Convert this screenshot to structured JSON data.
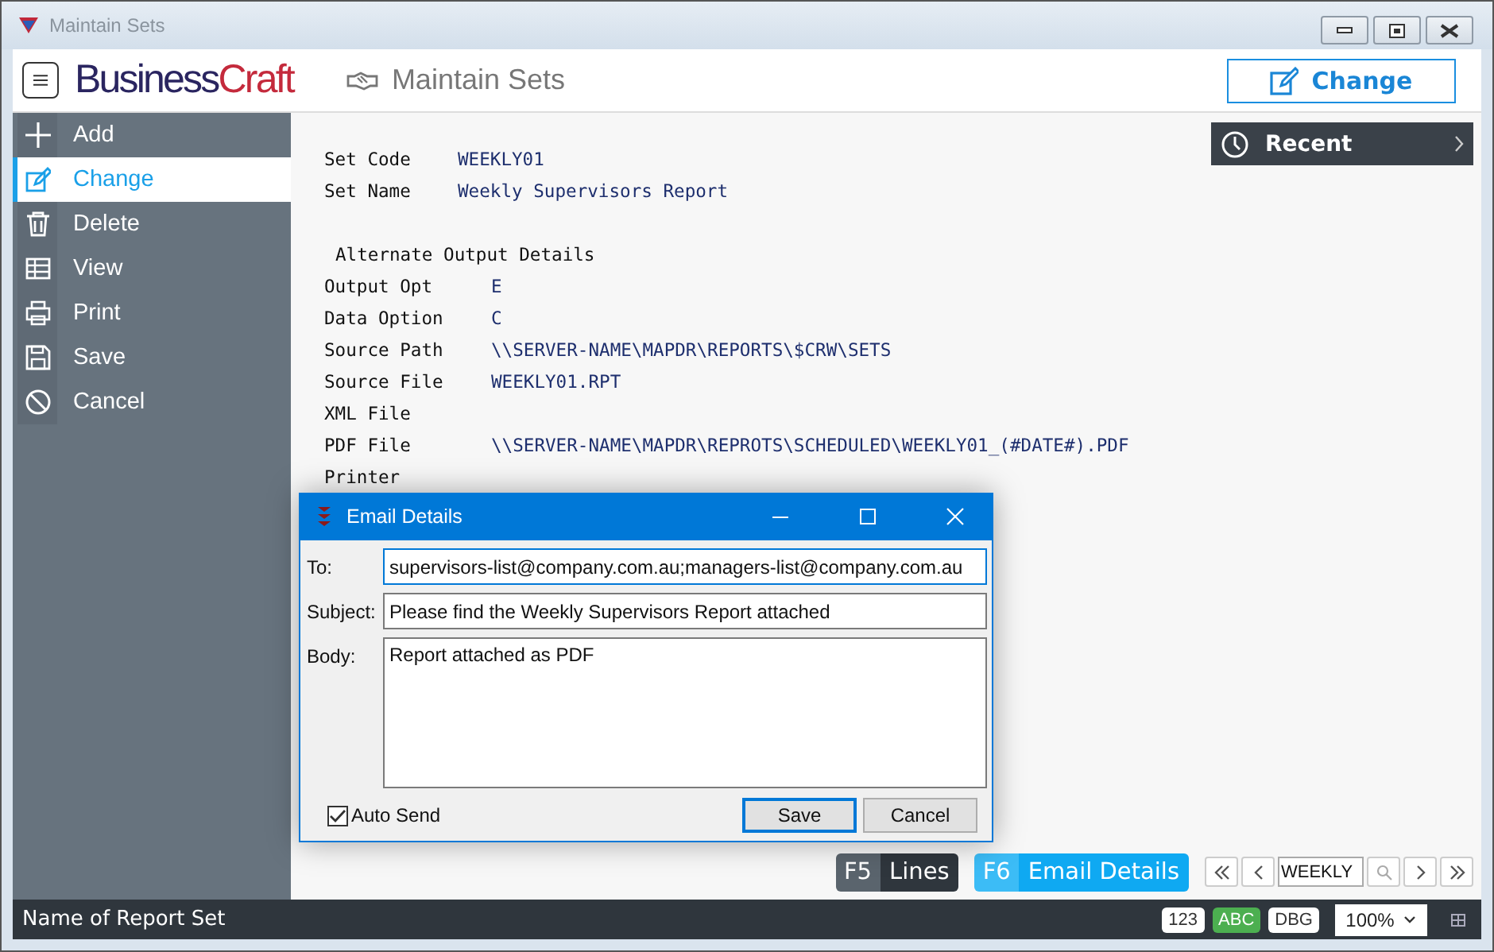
{
  "window": {
    "title": "Maintain Sets"
  },
  "header": {
    "logo": {
      "first": "Business",
      "second": "Craft"
    },
    "title": "Maintain Sets",
    "mode_button": "Change"
  },
  "sidebar": {
    "items": [
      {
        "label": "Add",
        "selected": false
      },
      {
        "label": "Change",
        "selected": true
      },
      {
        "label": "Delete",
        "selected": false
      },
      {
        "label": "View",
        "selected": false
      },
      {
        "label": "Print",
        "selected": false
      },
      {
        "label": "Save",
        "selected": false
      },
      {
        "label": "Cancel",
        "selected": false
      }
    ]
  },
  "record": {
    "fields": [
      {
        "label": "Set Code",
        "value": "WEEKLY01"
      },
      {
        "label": "Set Name",
        "value": "Weekly Supervisors Report"
      }
    ],
    "section_title": "Alternate Output Details",
    "details": [
      {
        "label": "Output Opt",
        "value": "E"
      },
      {
        "label": "Data Option",
        "value": "C"
      },
      {
        "label": "Source Path",
        "value": "\\\\SERVER-NAME\\MAPDR\\REPORTS\\$CRW\\SETS"
      },
      {
        "label": "Source File",
        "value": "WEEKLY01.RPT"
      },
      {
        "label": "XML File"
      },
      {
        "label": "PDF File",
        "value": "\\\\SERVER-NAME\\MAPDR\\REPROTS\\SCHEDULED\\WEEKLY01_(#DATE#).PDF"
      },
      {
        "label": "Printer"
      }
    ]
  },
  "recent": {
    "label": "Recent"
  },
  "function_keys": [
    {
      "key": "F5",
      "label": "Lines",
      "highlighted": false
    },
    {
      "key": "F6",
      "label": "Email Details",
      "highlighted": true
    }
  ],
  "navigator": {
    "value": "WEEKLY"
  },
  "dialog": {
    "title": "Email Details",
    "to_label": "To:",
    "to": "supervisors-list@company.com.au;managers-list@company.com.au",
    "subject_label": "Subject:",
    "subject": "Please find the Weekly Supervisors Report attached",
    "body_label": "Body:",
    "body": "Report attached as PDF",
    "auto_send": {
      "label": "Auto Send",
      "checked": true
    },
    "buttons": [
      {
        "label": "Save",
        "default": true
      },
      {
        "label": "Cancel",
        "default": false
      }
    ]
  },
  "status_bar": {
    "text": "Name of Report Set",
    "modes": [
      {
        "label": "123",
        "on": false
      },
      {
        "label": "ABC",
        "on": true
      },
      {
        "label": "DBG",
        "on": false
      }
    ],
    "zoom": "100%"
  }
}
